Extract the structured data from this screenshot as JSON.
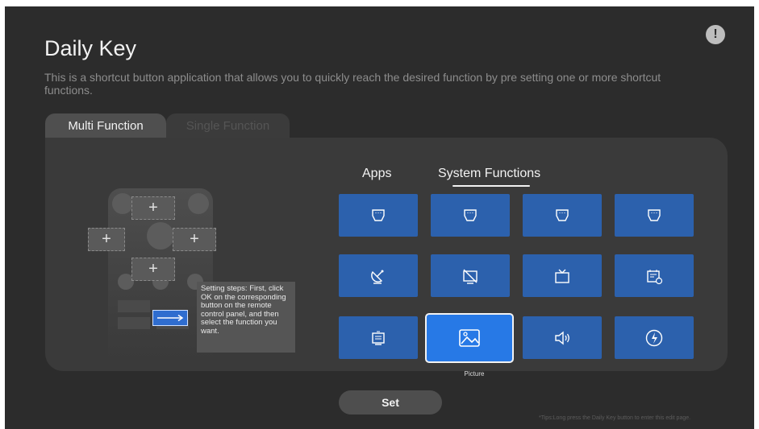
{
  "header": {
    "title": "Daily Key",
    "description": "This is a shortcut button application that allows you to quickly reach the desired function by pre setting one or more shortcut functions."
  },
  "tabs": [
    {
      "label": "Multi Function",
      "active": true
    },
    {
      "label": "Single Function",
      "active": false
    }
  ],
  "remote": {
    "slot_symbol": "+",
    "setting_steps": "Setting steps: First, click OK on the corresponding button on the remote control panel, and then select the function you want."
  },
  "categories": [
    {
      "label": "Apps",
      "active": false
    },
    {
      "label": "System Functions",
      "active": true
    }
  ],
  "tiles": [
    {
      "icon": "hdmi-icon"
    },
    {
      "icon": "hdmi-icon"
    },
    {
      "icon": "hdmi-icon"
    },
    {
      "icon": "hdmi-icon"
    },
    {
      "icon": "satellite-icon"
    },
    {
      "icon": "tv-off-icon"
    },
    {
      "icon": "tv-icon"
    },
    {
      "icon": "epg-schedule-icon"
    },
    {
      "icon": "channel-list-icon"
    },
    {
      "icon": "picture-icon",
      "label": "Picture",
      "selected": true
    },
    {
      "icon": "volume-icon"
    },
    {
      "icon": "power-mode-icon"
    }
  ],
  "set_button": "Set",
  "tips": "*Tips:Long press the Daily Key button to enter this edit page.",
  "colors": {
    "background": "#2c2c2c",
    "panel": "#3a3a3a",
    "tile": "#2c61ad",
    "tile_selected": "#2779e6"
  }
}
